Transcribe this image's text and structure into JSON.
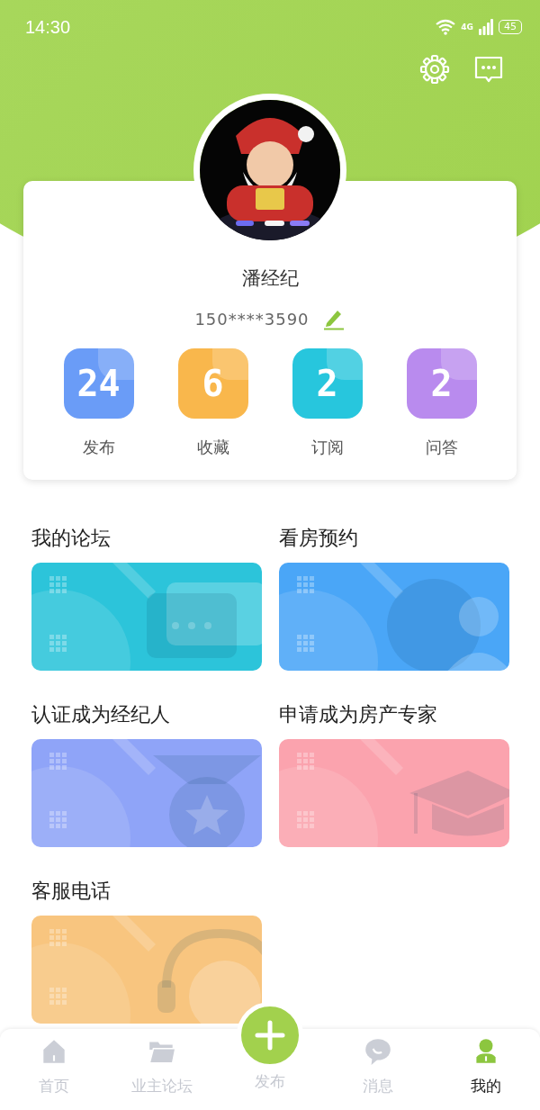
{
  "status_bar": {
    "time": "14:30",
    "network": "4G",
    "battery": "45"
  },
  "profile": {
    "name": "潘经纪",
    "phone": "150****3590"
  },
  "stats": [
    {
      "value": "24",
      "label": "发布",
      "color": "#6a9cf7"
    },
    {
      "value": "6",
      "label": "收藏",
      "color": "#f9b74c"
    },
    {
      "value": "2",
      "label": "订阅",
      "color": "#27c6dd"
    },
    {
      "value": "2",
      "label": "问答",
      "color": "#b98bee"
    }
  ],
  "services": [
    {
      "title": "我的论坛",
      "kind": "forum",
      "color": "#2cc4da"
    },
    {
      "title": "看房预约",
      "kind": "appointment",
      "color": "#4aa6f7"
    },
    {
      "title": "认证成为经纪人",
      "kind": "certify",
      "color": "#8fa4f8"
    },
    {
      "title": "申请成为房产专家",
      "kind": "expert",
      "color": "#fba3ae"
    },
    {
      "title": "客服电话",
      "kind": "phone",
      "color": "#f8c57f"
    }
  ],
  "tab_bar": [
    {
      "label": "首页",
      "kind": "home",
      "selected": false
    },
    {
      "label": "业主论坛",
      "kind": "folder",
      "selected": false
    },
    {
      "label": "发布",
      "kind": "publish",
      "selected": false
    },
    {
      "label": "消息",
      "kind": "message",
      "selected": false
    },
    {
      "label": "我的",
      "kind": "me",
      "selected": true
    }
  ]
}
